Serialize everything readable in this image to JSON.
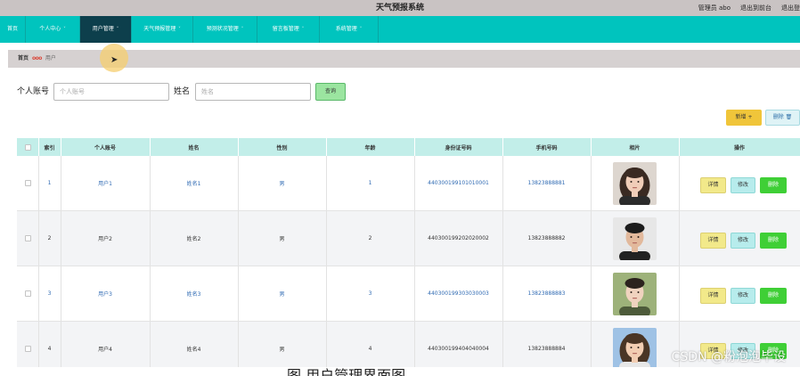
{
  "header": {
    "title": "天气预报系统",
    "admin_text": "管理员 abo",
    "back_text": "退出到前台",
    "logout_text": "退出登"
  },
  "nav": [
    {
      "label": "首页",
      "chevron": false
    },
    {
      "label": "个人中心",
      "chevron": true
    },
    {
      "label": "用户管理",
      "chevron": true,
      "active": true
    },
    {
      "label": "天气预报管理",
      "chevron": true
    },
    {
      "label": "预测状况管理",
      "chevron": true
    },
    {
      "label": "留言板管理",
      "chevron": true
    },
    {
      "label": "系统管理",
      "chevron": true
    }
  ],
  "breadcrumb": {
    "home": "首页",
    "separator": "ooo",
    "current": "用户"
  },
  "search": {
    "account_label": "个人账号",
    "account_placeholder": "个人账号",
    "name_label": "姓名",
    "name_placeholder": "姓名",
    "query_label": "查询"
  },
  "actions": {
    "add_label": "新增 +",
    "delete_label": "删除 🗑"
  },
  "table": {
    "headers": [
      "",
      "索引",
      "个人账号",
      "姓名",
      "性别",
      "年龄",
      "身份证号码",
      "手机号码",
      "相片",
      "操作"
    ],
    "rows": [
      {
        "index": "1",
        "account": "用户1",
        "name": "姓名1",
        "gender": "男",
        "age": "1",
        "id_card": "440300199101010001",
        "phone": "13823888881",
        "detail": "详情",
        "edit": "修改",
        "delete": "删除",
        "photo": "female-portrait"
      },
      {
        "index": "2",
        "account": "用户2",
        "name": "姓名2",
        "gender": "男",
        "age": "2",
        "id_card": "440300199202020002",
        "phone": "13823888882",
        "detail": "详情",
        "edit": "修改",
        "delete": "删除",
        "photo": "male-portrait"
      },
      {
        "index": "3",
        "account": "用户3",
        "name": "姓名3",
        "gender": "男",
        "age": "3",
        "id_card": "440300199303030003",
        "phone": "13823888883",
        "detail": "详情",
        "edit": "修改",
        "delete": "删除",
        "photo": "male-portrait-outdoor"
      },
      {
        "index": "4",
        "account": "用户4",
        "name": "姓名4",
        "gender": "男",
        "age": "4",
        "id_card": "440300199404040004",
        "phone": "13823888884",
        "detail": "详情",
        "edit": "修改",
        "delete": "删除",
        "photo": "female-portrait-outdoor"
      }
    ]
  },
  "watermark": "CSDN @粉泡泡毕设",
  "caption": "图 用户管理界面图",
  "colors": {
    "nav_bg": "#00c4be",
    "nav_active": "#0d3f4c",
    "table_header": "#c2eee9",
    "add_button": "#f0c53a",
    "delete_button": "#3fcf36",
    "link_blue": "#2f6ab3"
  }
}
